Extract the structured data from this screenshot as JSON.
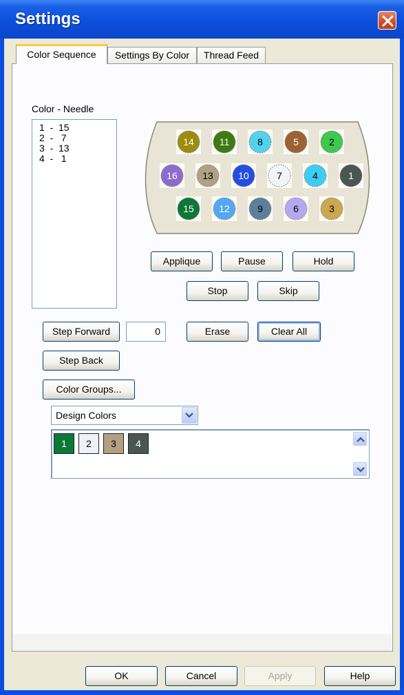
{
  "window": {
    "title": "Settings"
  },
  "tabs": [
    "Color Sequence",
    "Settings By Color",
    "Thread Feed"
  ],
  "color_needle": {
    "label": "Color - Needle",
    "items": [
      "1  -  15",
      "2  -   7",
      "3  -  13",
      "4  -   1"
    ]
  },
  "needles": [
    {
      "num": "14",
      "color": "#9c8c10",
      "text_color": "#ffffff"
    },
    {
      "num": "11",
      "color": "#3f7a12",
      "text_color": "#ffffff"
    },
    {
      "num": "8",
      "color": "#52d2ec",
      "text_color": "#000000"
    },
    {
      "num": "5",
      "color": "#9a6334",
      "text_color": "#ffffff"
    },
    {
      "num": "2",
      "color": "#3fc74f",
      "text_color": "#000000"
    },
    {
      "num": "16",
      "color": "#8a6ccc",
      "text_color": "#ffffff"
    },
    {
      "num": "13",
      "color": "#b2a084",
      "text_color": "#000000"
    },
    {
      "num": "10",
      "color": "#244ee0",
      "text_color": "#ffffff"
    },
    {
      "num": "7",
      "color": "#f2f5f8",
      "text_color": "#000000"
    },
    {
      "num": "4",
      "color": "#3dccf4",
      "text_color": "#000000"
    },
    {
      "num": "1",
      "color": "#4a5652",
      "text_color": "#ffffff"
    },
    {
      "num": "15",
      "color": "#0c7838",
      "text_color": "#ffffff"
    },
    {
      "num": "12",
      "color": "#52a8f2",
      "text_color": "#ffffff"
    },
    {
      "num": "9",
      "color": "#5e7f9c",
      "text_color": "#000000"
    },
    {
      "num": "6",
      "color": "#b6a8ee",
      "text_color": "#000000"
    },
    {
      "num": "3",
      "color": "#c9a850",
      "text_color": "#000000"
    }
  ],
  "buttons": {
    "applique": "Applique",
    "pause": "Pause",
    "hold": "Hold",
    "stop": "Stop",
    "skip": "Skip",
    "step_forward": "Step Forward",
    "erase": "Erase",
    "clear_all": "Clear All",
    "step_back": "Step Back",
    "color_groups": "Color Groups..."
  },
  "step_counter": "0",
  "design_colors": {
    "selected": "Design Colors",
    "swatches": [
      {
        "num": "1",
        "color": "#0c7838",
        "text_color": "#ffffff"
      },
      {
        "num": "2",
        "color": "#eef2f6",
        "text_color": "#000000"
      },
      {
        "num": "3",
        "color": "#b2a084",
        "text_color": "#000000"
      },
      {
        "num": "4",
        "color": "#4a5652",
        "text_color": "#ffffff"
      }
    ]
  },
  "footer": {
    "ok": "OK",
    "cancel": "Cancel",
    "apply": "Apply",
    "help": "Help"
  }
}
